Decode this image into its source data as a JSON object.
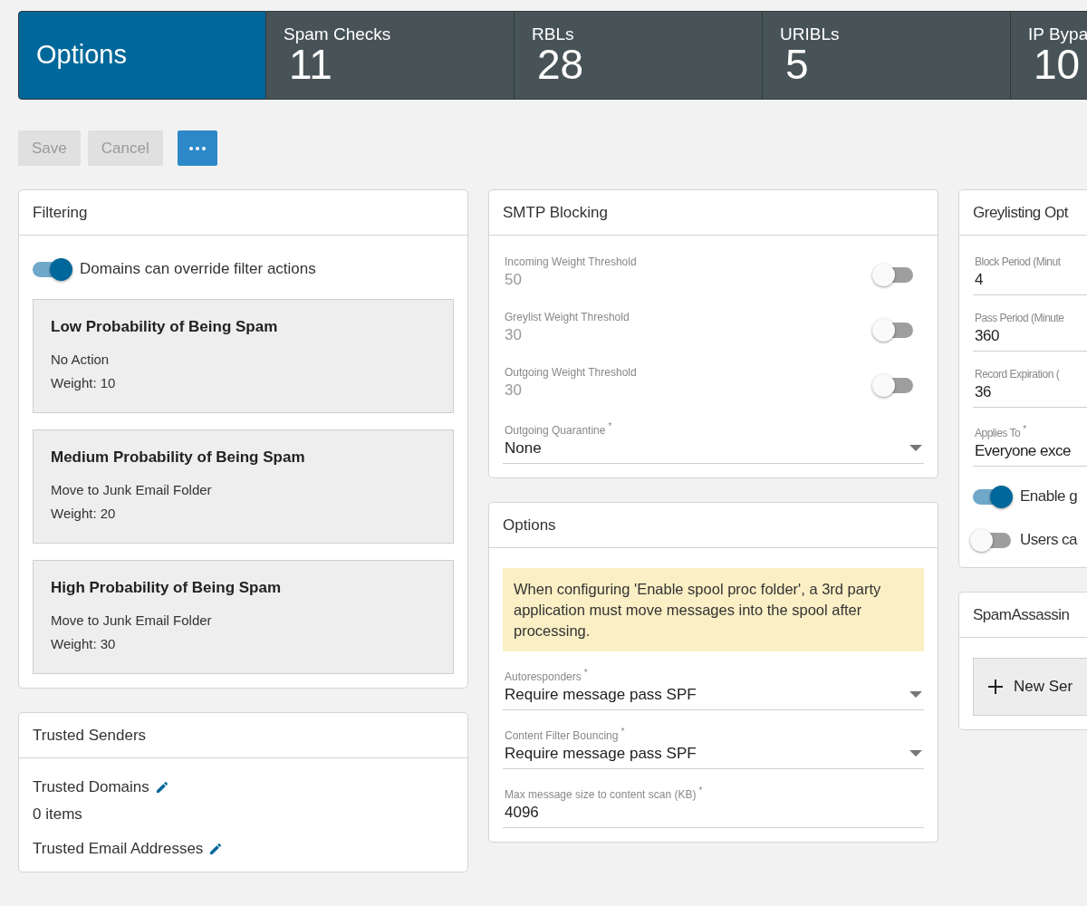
{
  "header_tabs": [
    {
      "label": "Options",
      "selected": true
    },
    {
      "label": "Spam Checks",
      "count": "11",
      "selected": false
    },
    {
      "label": "RBLs",
      "count": "28",
      "selected": false
    },
    {
      "label": "URIBLs",
      "count": "5",
      "selected": false
    },
    {
      "label": "IP Bypa",
      "count": "10",
      "selected": false
    }
  ],
  "toolbar": {
    "buttons": [
      {
        "label": "Save",
        "disabled": true
      },
      {
        "label": "Cancel",
        "disabled": true
      }
    ]
  },
  "columns": [
    [
      {
        "title": "Filtering",
        "items": [
          {
            "kind": "toggle",
            "label": "Domains can override filter actions",
            "on": true
          },
          {
            "kind": "rule",
            "title": "Low Probability of Being Spam",
            "action": "No Action",
            "weight": "Weight: 10"
          },
          {
            "kind": "rule",
            "title": "Medium Probability of Being Spam",
            "action": "Move to Junk Email Folder",
            "weight": "Weight: 20"
          },
          {
            "kind": "rule",
            "title": "High Probability of Being Spam",
            "action": "Move to Junk Email Folder",
            "weight": "Weight: 30"
          }
        ]
      },
      {
        "title": "Trusted Senders",
        "items": [
          {
            "kind": "list",
            "label": "Trusted Domains",
            "count": "0 items"
          },
          {
            "kind": "list",
            "label": "Trusted Email Addresses"
          }
        ]
      }
    ],
    [
      {
        "title": "SMTP Blocking",
        "items": [
          {
            "kind": "toggle_field",
            "label": "Incoming Weight Threshold",
            "value": "50",
            "on": false
          },
          {
            "kind": "toggle_field",
            "label": "Greylist Weight Threshold",
            "value": "30",
            "on": false
          },
          {
            "kind": "toggle_field",
            "label": "Outgoing Weight Threshold",
            "value": "30",
            "on": false
          },
          {
            "kind": "select",
            "label": "Outgoing Quarantine",
            "required_mark": "*",
            "value": "None"
          }
        ]
      },
      {
        "title": "Options",
        "items": [
          {
            "kind": "notice",
            "text": "When configuring 'Enable spool proc folder', a 3rd party application must move messages into the spool after processing."
          },
          {
            "kind": "select",
            "label": "Autoresponders",
            "required_mark": "*",
            "value": "Require message pass SPF"
          },
          {
            "kind": "select",
            "label": "Content Filter Bouncing",
            "required_mark": "*",
            "value": "Require message pass SPF"
          },
          {
            "kind": "field",
            "label": "Max message size to content scan (KB)",
            "required_mark": "*",
            "value": "4096"
          }
        ]
      }
    ],
    [
      {
        "title": "Greylisting Opt",
        "items": [
          {
            "kind": "field",
            "label": "Block Period (Minut",
            "value": "4"
          },
          {
            "kind": "field",
            "label": "Pass Period (Minute",
            "value": "360"
          },
          {
            "kind": "field",
            "label": "Record Expiration (",
            "value": "36"
          },
          {
            "kind": "field",
            "label": "Applies To",
            "required_mark": "*",
            "value": "Everyone exce"
          },
          {
            "kind": "toggle",
            "label": "Enable g",
            "on": true
          },
          {
            "kind": "toggle",
            "label": "Users ca",
            "on": false
          }
        ]
      },
      {
        "title": "SpamAssassin",
        "items": [
          {
            "kind": "add_button",
            "label": "New Ser"
          }
        ]
      }
    ]
  ]
}
